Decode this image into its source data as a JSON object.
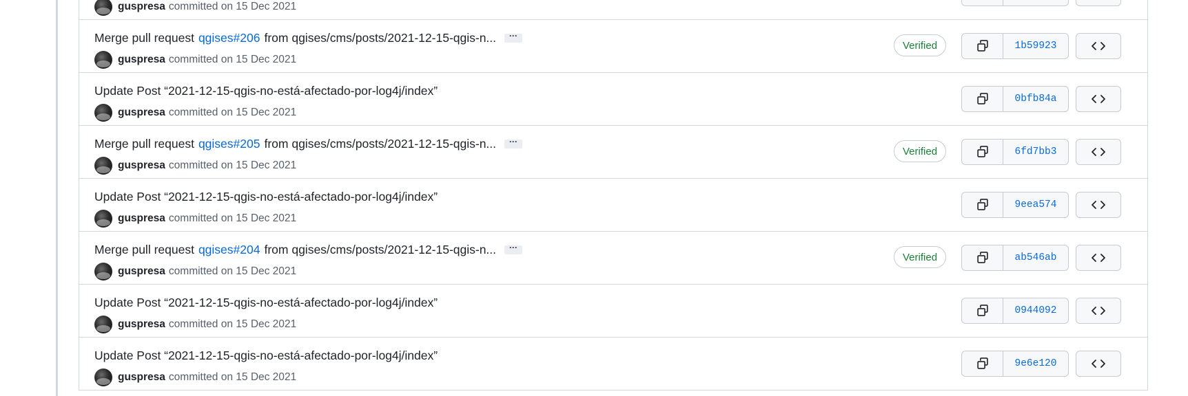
{
  "commits": [
    {
      "title_prefix": "",
      "pr": "",
      "title_suffix": "",
      "author": "guspresa",
      "meta": "committed on 15 Dec 2021",
      "verified": "",
      "sha": ""
    },
    {
      "title_prefix": "Merge pull request",
      "pr": "qgises#206",
      "title_suffix": "from qgises/cms/posts/2021-12-15-qgis-n...",
      "has_ellipsis": true,
      "ellipsis": "···",
      "author": "guspresa",
      "meta": "committed on 15 Dec 2021",
      "verified": "Verified",
      "sha": "1b59923"
    },
    {
      "title_prefix": "Update Post “2021-12-15-qgis-no-está-afectado-por-log4j/index”",
      "pr": "",
      "title_suffix": "",
      "author": "guspresa",
      "meta": "committed on 15 Dec 2021",
      "verified": "",
      "sha": "0bfb84a"
    },
    {
      "title_prefix": "Merge pull request",
      "pr": "qgises#205",
      "title_suffix": "from qgises/cms/posts/2021-12-15-qgis-n...",
      "has_ellipsis": true,
      "ellipsis": "···",
      "author": "guspresa",
      "meta": "committed on 15 Dec 2021",
      "verified": "Verified",
      "sha": "6fd7bb3"
    },
    {
      "title_prefix": "Update Post “2021-12-15-qgis-no-está-afectado-por-log4j/index”",
      "pr": "",
      "title_suffix": "",
      "author": "guspresa",
      "meta": "committed on 15 Dec 2021",
      "verified": "",
      "sha": "9eea574"
    },
    {
      "title_prefix": "Merge pull request",
      "pr": "qgises#204",
      "title_suffix": "from qgises/cms/posts/2021-12-15-qgis-n...",
      "has_ellipsis": true,
      "ellipsis": "···",
      "author": "guspresa",
      "meta": "committed on 15 Dec 2021",
      "verified": "Verified",
      "sha": "ab546ab"
    },
    {
      "title_prefix": "Update Post “2021-12-15-qgis-no-está-afectado-por-log4j/index”",
      "pr": "",
      "title_suffix": "",
      "author": "guspresa",
      "meta": "committed on 15 Dec 2021",
      "verified": "",
      "sha": "0944092"
    },
    {
      "title_prefix": "Update Post “2021-12-15-qgis-no-está-afectado-por-log4j/index”",
      "pr": "",
      "title_suffix": "",
      "author": "guspresa",
      "meta": "committed on 15 Dec 2021",
      "verified": "",
      "sha": "9e6e120"
    }
  ],
  "icons": {
    "copy": "copy-icon",
    "browse": "code-icon",
    "ellipsis": "ellipsis-icon"
  },
  "colors": {
    "link": "#0969da",
    "verified": "#1a7f37",
    "border": "#d0d7de",
    "button_bg": "#f6f8fa"
  }
}
